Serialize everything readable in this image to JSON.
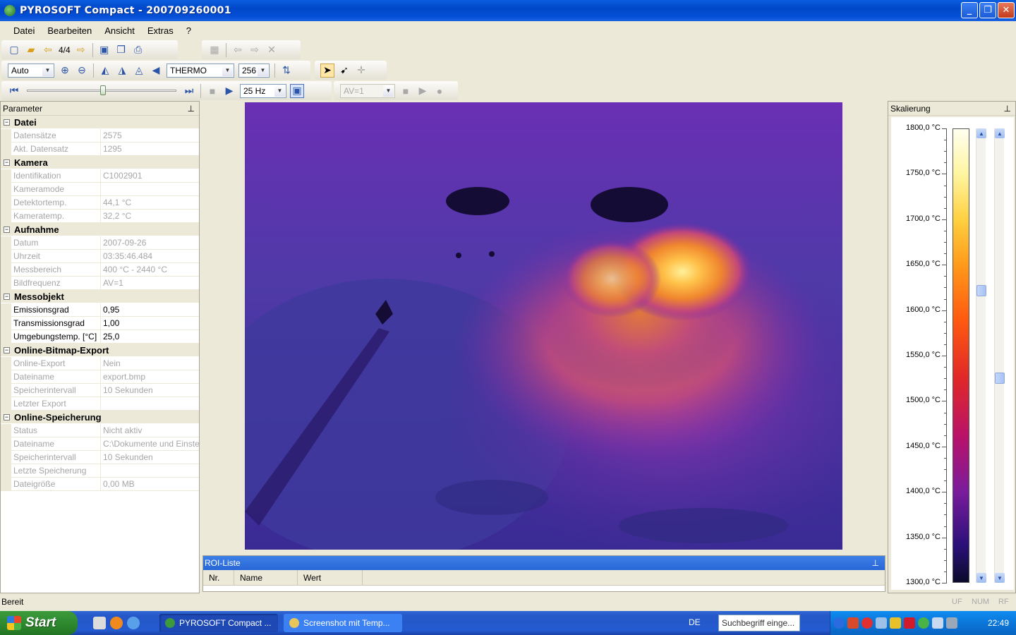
{
  "window": {
    "title": "PYROSOFT Compact - 200709260001"
  },
  "window_buttons": {
    "minimize": "_",
    "maximize": "❐",
    "close": "✕"
  },
  "menu": [
    "Datei",
    "Bearbeiten",
    "Ansicht",
    "Extras",
    "?"
  ],
  "toolbar1": {
    "frame_counter": "4/4"
  },
  "toolbar2": {
    "zoom_mode": "Auto",
    "palette": "THERMO",
    "colors": "256"
  },
  "toolbar3": {
    "frequency": "25 Hz",
    "averaging": "AV=1"
  },
  "parameter_panel": {
    "title": "Parameter",
    "categories": [
      {
        "name": "Datei",
        "rows": [
          {
            "key": "Datensätze",
            "value": "2575",
            "readonly": true
          },
          {
            "key": "Akt. Datensatz",
            "value": "1295",
            "readonly": true
          }
        ]
      },
      {
        "name": "Kamera",
        "rows": [
          {
            "key": "Identifikation",
            "value": "C1002901",
            "readonly": true
          },
          {
            "key": "Kameramode",
            "value": "",
            "readonly": true
          },
          {
            "key": "Detektortemp.",
            "value": "44,1 °C",
            "readonly": true
          },
          {
            "key": "Kameratemp.",
            "value": "32,2 °C",
            "readonly": true
          }
        ]
      },
      {
        "name": "Aufnahme",
        "rows": [
          {
            "key": "Datum",
            "value": "2007-09-26",
            "readonly": true
          },
          {
            "key": "Uhrzeit",
            "value": "03:35:46.484",
            "readonly": true
          },
          {
            "key": "Messbereich",
            "value": "400 °C - 2440 °C",
            "readonly": true
          },
          {
            "key": "Bildfrequenz",
            "value": "AV=1",
            "readonly": true
          }
        ]
      },
      {
        "name": "Messobjekt",
        "rows": [
          {
            "key": "Emissionsgrad",
            "value": "0,95",
            "readonly": false
          },
          {
            "key": "Transmissionsgrad",
            "value": "1,00",
            "readonly": false
          },
          {
            "key": "Umgebungstemp. [°C]",
            "value": "25,0",
            "readonly": false
          }
        ]
      },
      {
        "name": "Online-Bitmap-Export",
        "rows": [
          {
            "key": "Online-Export",
            "value": "Nein",
            "readonly": true
          },
          {
            "key": "Dateiname",
            "value": "export.bmp",
            "readonly": true
          },
          {
            "key": "Speicherintervall",
            "value": "10 Sekunden",
            "readonly": true
          },
          {
            "key": "Letzter Export",
            "value": "",
            "readonly": true
          }
        ]
      },
      {
        "name": "Online-Speicherung",
        "rows": [
          {
            "key": "Status",
            "value": "Nicht aktiv",
            "readonly": true
          },
          {
            "key": "Dateiname",
            "value": "C:\\Dokumente und Einste",
            "readonly": true
          },
          {
            "key": "Speicherintervall",
            "value": "10 Sekunden",
            "readonly": true
          },
          {
            "key": "Letzte Speicherung",
            "value": "",
            "readonly": true
          },
          {
            "key": "Dateigröße",
            "value": "0,00 MB",
            "readonly": true
          }
        ]
      }
    ]
  },
  "roi_list": {
    "title": "ROI-Liste",
    "columns": [
      "Nr.",
      "Name",
      "Wert"
    ]
  },
  "scale_panel": {
    "title": "Skalierung",
    "labels": [
      "1800,0 °C",
      "1750,0 °C",
      "1700,0 °C",
      "1650,0 °C",
      "1600,0 °C",
      "1550,0 °C",
      "1500,0 °C",
      "1450,0 °C",
      "1400,0 °C",
      "1350,0 °C",
      "1300,0 °C"
    ]
  },
  "statusbar": {
    "text": "Bereit",
    "indicators": [
      "UF",
      "NUM",
      "RF"
    ]
  },
  "taskbar": {
    "start": "Start",
    "tasks": [
      "PYROSOFT Compact ...",
      "Screenshot mit Temp..."
    ],
    "language": "DE",
    "search_placeholder": "Suchbegriff einge...",
    "clock": "22:49"
  },
  "colors": {
    "titlebar": "#0a5fe0",
    "taskbar": "#245bd0",
    "start": "#2f8a2f",
    "roi_header": "#2867d6"
  }
}
